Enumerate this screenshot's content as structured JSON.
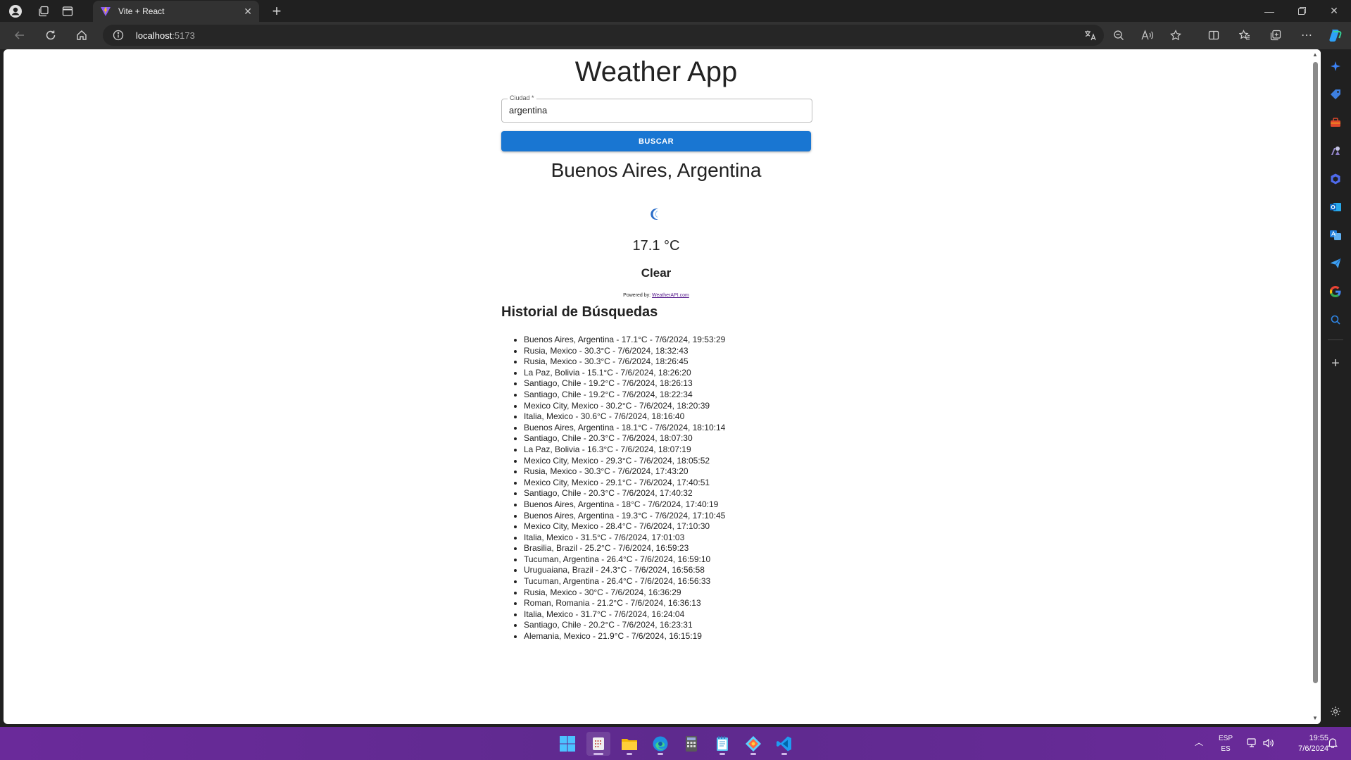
{
  "browser": {
    "tab_title": "Vite + React",
    "address_host": "localhost",
    "address_port": ":5173"
  },
  "app": {
    "title": "Weather App",
    "search": {
      "label": "Ciudad *",
      "value": "argentina",
      "button_label": "BUSCAR"
    },
    "result": {
      "location": "Buenos Aires, Argentina",
      "icon": "crescent-moon-icon",
      "temperature": "17.1 °C",
      "condition": "Clear",
      "powered_by": "Powered by:",
      "powered_link": "WeatherAPI.com"
    },
    "history": {
      "title": "Historial de Búsquedas",
      "items": [
        "Buenos Aires, Argentina - 17.1°C - 7/6/2024, 19:53:29",
        "Rusia, Mexico - 30.3°C - 7/6/2024, 18:32:43",
        "Rusia, Mexico - 30.3°C - 7/6/2024, 18:26:45",
        "La Paz, Bolivia - 15.1°C - 7/6/2024, 18:26:20",
        "Santiago, Chile - 19.2°C - 7/6/2024, 18:26:13",
        "Santiago, Chile - 19.2°C - 7/6/2024, 18:22:34",
        "Mexico City, Mexico - 30.2°C - 7/6/2024, 18:20:39",
        "Italia, Mexico - 30.6°C - 7/6/2024, 18:16:40",
        "Buenos Aires, Argentina - 18.1°C - 7/6/2024, 18:10:14",
        "Santiago, Chile - 20.3°C - 7/6/2024, 18:07:30",
        "La Paz, Bolivia - 16.3°C - 7/6/2024, 18:07:19",
        "Mexico City, Mexico - 29.3°C - 7/6/2024, 18:05:52",
        "Rusia, Mexico - 30.3°C - 7/6/2024, 17:43:20",
        "Mexico City, Mexico - 29.1°C - 7/6/2024, 17:40:51",
        "Santiago, Chile - 20.3°C - 7/6/2024, 17:40:32",
        "Buenos Aires, Argentina - 18°C - 7/6/2024, 17:40:19",
        "Buenos Aires, Argentina - 19.3°C - 7/6/2024, 17:10:45",
        "Mexico City, Mexico - 28.4°C - 7/6/2024, 17:10:30",
        "Italia, Mexico - 31.5°C - 7/6/2024, 17:01:03",
        "Brasilia, Brazil - 25.2°C - 7/6/2024, 16:59:23",
        "Tucuman, Argentina - 26.4°C - 7/6/2024, 16:59:10",
        "Uruguaiana, Brazil - 24.3°C - 7/6/2024, 16:56:58",
        "Tucuman, Argentina - 26.4°C - 7/6/2024, 16:56:33",
        "Rusia, Mexico - 30°C - 7/6/2024, 16:36:29",
        "Roman, Romania - 21.2°C - 7/6/2024, 16:36:13",
        "Italia, Mexico - 31.7°C - 7/6/2024, 16:24:04",
        "Santiago, Chile - 20.2°C - 7/6/2024, 16:23:31",
        "Alemania, Mexico - 21.9°C - 7/6/2024, 16:15:19"
      ]
    }
  },
  "taskbar": {
    "lang_top": "ESP",
    "lang_bottom": "ES",
    "time": "19:55",
    "date": "7/6/2024"
  },
  "colors": {
    "primary_button": "#1976d2",
    "taskbar": "#5e2a8e",
    "link": "#551a8b"
  }
}
